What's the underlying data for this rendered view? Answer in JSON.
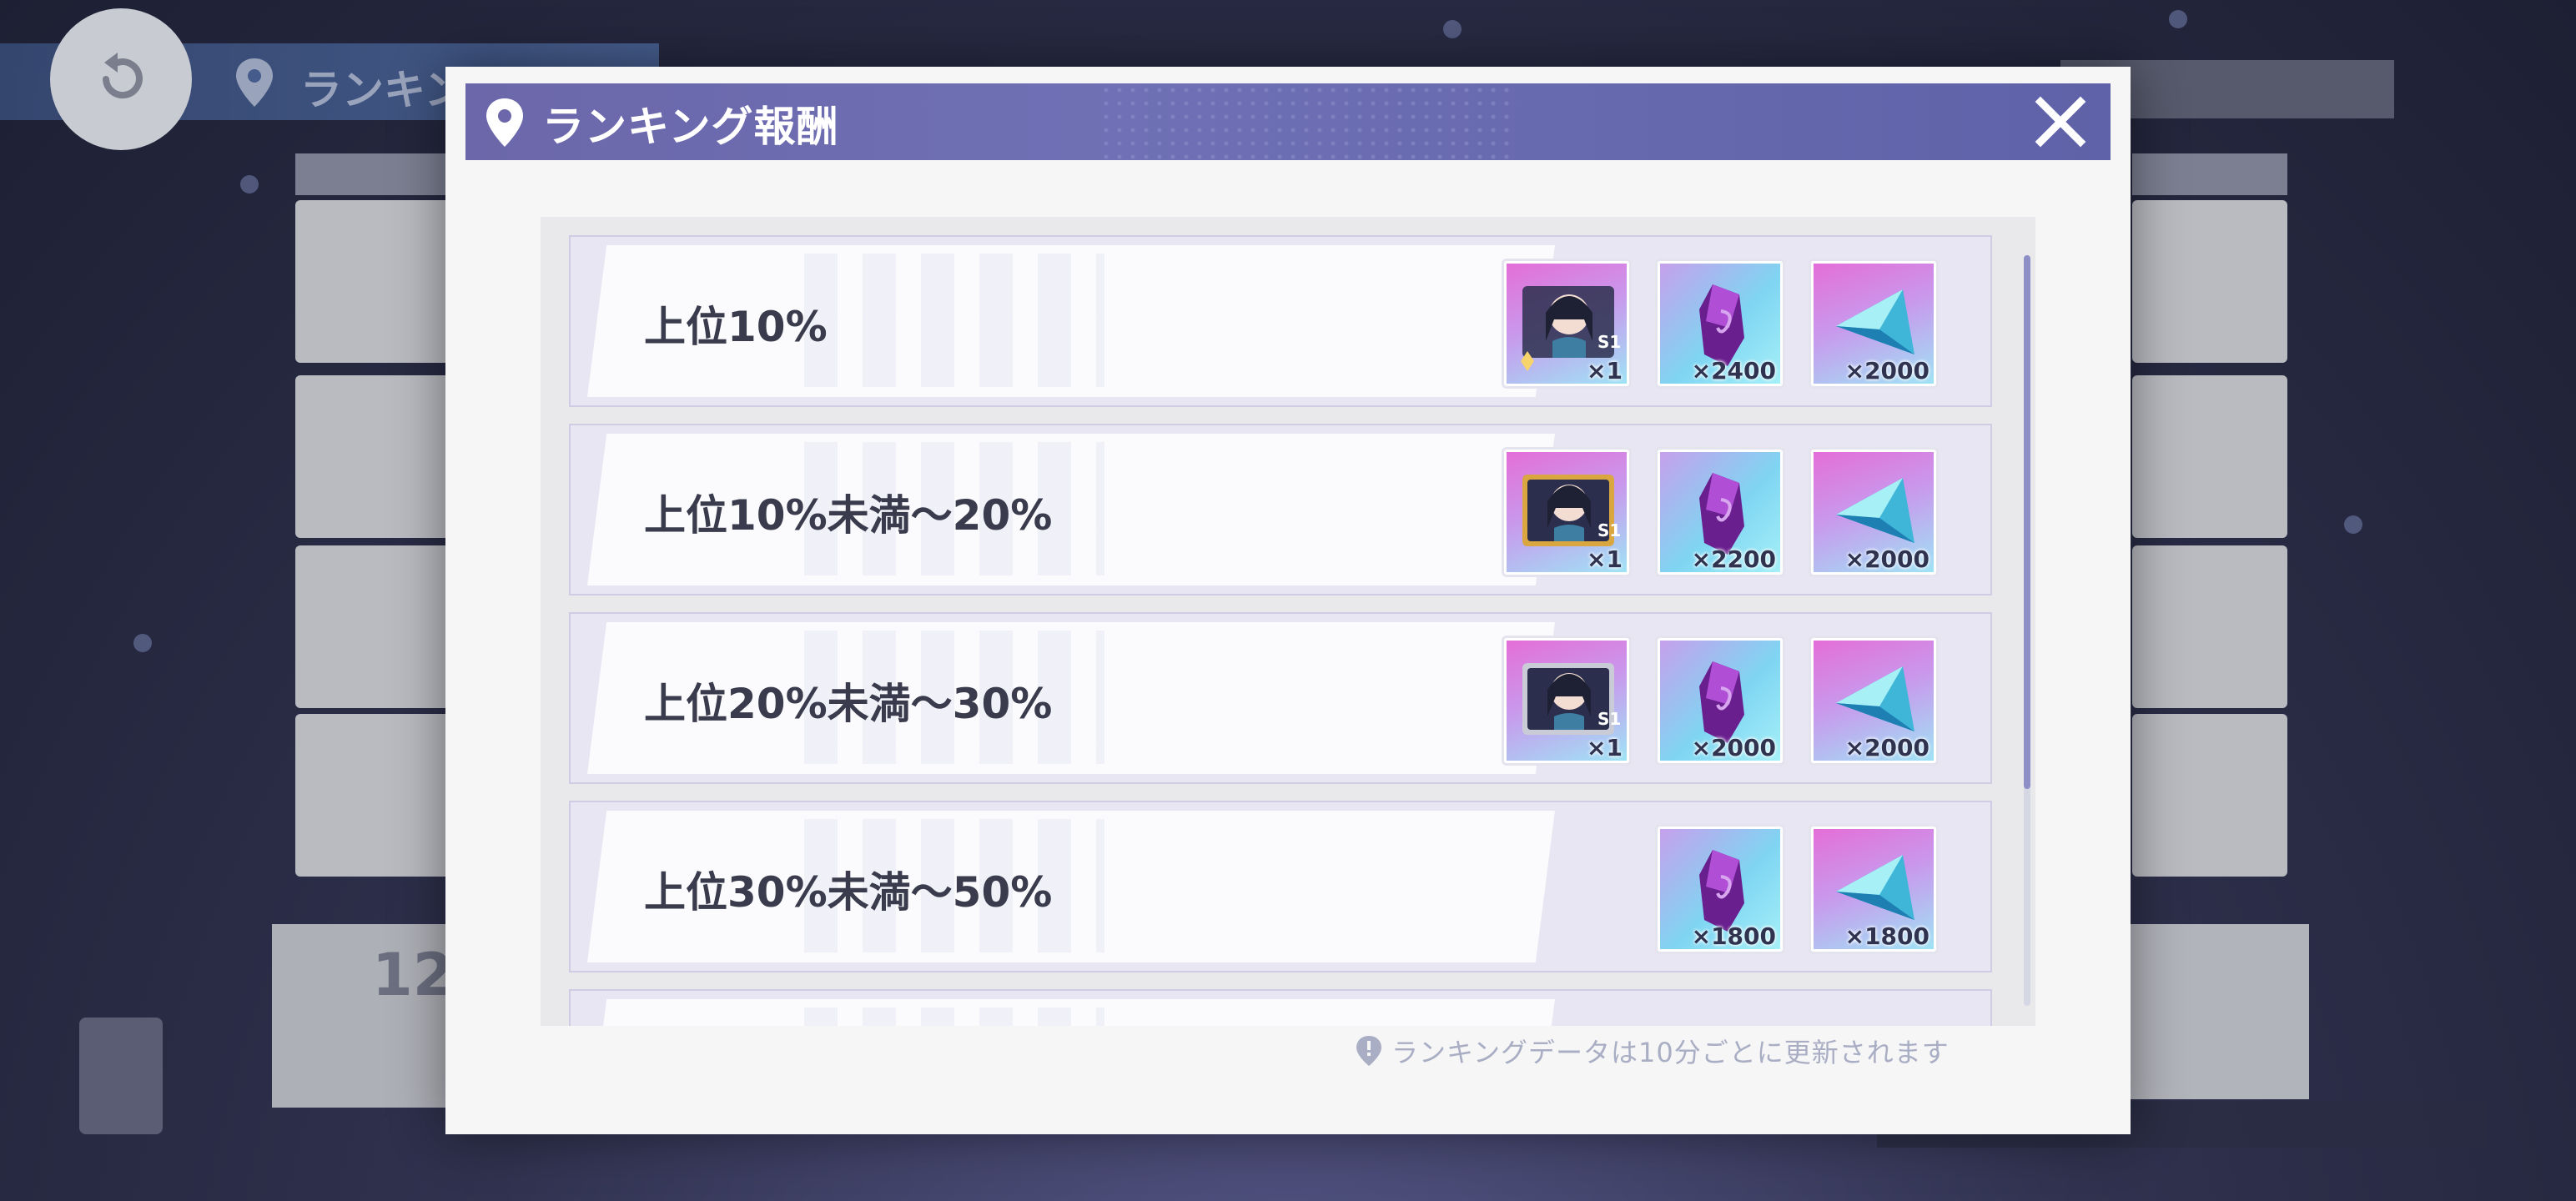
{
  "background": {
    "screen_title": "ランキング",
    "bottom_card_number": "12"
  },
  "modal": {
    "title": "ランキング報酬",
    "close_icon": "close-icon",
    "footnote": "ランキングデータは10分ごとに更新されます",
    "rows": [
      {
        "label": "上位10%",
        "rewards": [
          {
            "type": "character-card",
            "badge": "S1",
            "qty": "×1"
          },
          {
            "type": "purple-crystal",
            "qty": "×2400"
          },
          {
            "type": "blue-gem",
            "qty": "×2000"
          }
        ]
      },
      {
        "label": "上位10%未満～20%",
        "rewards": [
          {
            "type": "character-card",
            "badge": "S1",
            "qty": "×1"
          },
          {
            "type": "purple-crystal",
            "qty": "×2200"
          },
          {
            "type": "blue-gem",
            "qty": "×2000"
          }
        ]
      },
      {
        "label": "上位20%未満～30%",
        "rewards": [
          {
            "type": "character-card",
            "badge": "S1",
            "qty": "×1"
          },
          {
            "type": "purple-crystal",
            "qty": "×2000"
          },
          {
            "type": "blue-gem",
            "qty": "×2000"
          }
        ]
      },
      {
        "label": "上位30%未満～50%",
        "rewards": [
          {
            "type": "purple-crystal",
            "qty": "×1800"
          },
          {
            "type": "blue-gem",
            "qty": "×1800"
          }
        ]
      }
    ]
  }
}
